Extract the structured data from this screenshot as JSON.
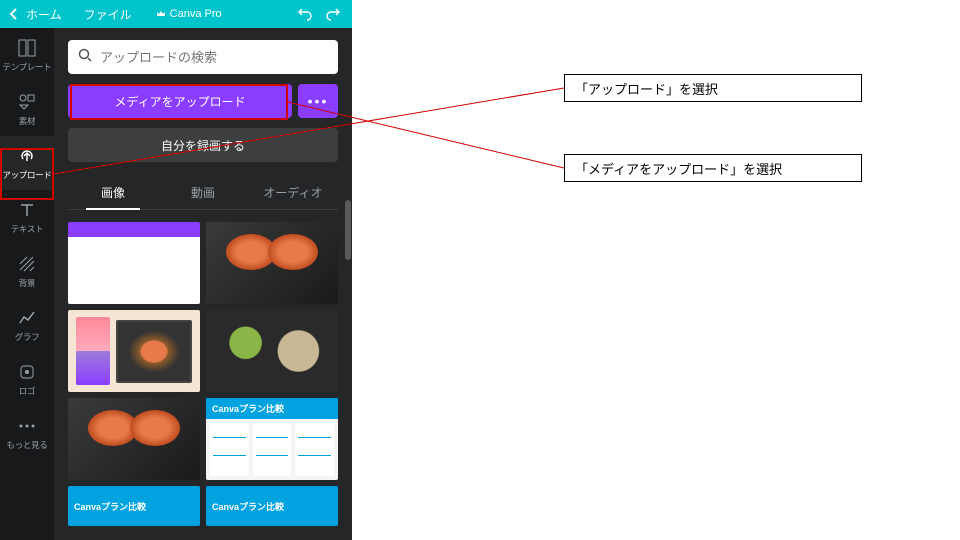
{
  "topbar": {
    "back_icon": "<",
    "home_label": "ホーム",
    "file_label": "ファイル",
    "pro_label": "Canva Pro"
  },
  "rail": {
    "items": [
      {
        "label": "テンプレート"
      },
      {
        "label": "素材"
      },
      {
        "label": "アップロード"
      },
      {
        "label": "テキスト"
      },
      {
        "label": "背景"
      },
      {
        "label": "グラフ"
      },
      {
        "label": "ロゴ"
      },
      {
        "label": "もっと見る"
      }
    ]
  },
  "panel": {
    "search_placeholder": "アップロードの検索",
    "upload_label": "メディアをアップロード",
    "more_label": "•••",
    "record_label": "自分を録画する",
    "tabs": [
      {
        "label": "画像"
      },
      {
        "label": "動画"
      },
      {
        "label": "オーディオ"
      }
    ],
    "plan_title": "Canvaプラン比較"
  },
  "annotations": {
    "a1": "「アップロード」を選択",
    "a2": "「メディアをアップロード」を選択"
  }
}
